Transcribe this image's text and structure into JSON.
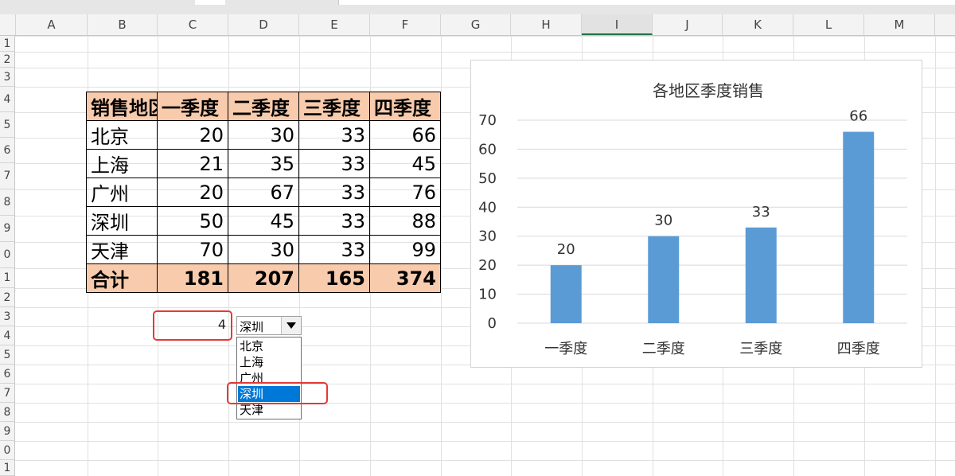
{
  "columns": [
    "A",
    "B",
    "C",
    "D",
    "E",
    "F",
    "G",
    "H",
    "I",
    "J",
    "K",
    "L",
    "M"
  ],
  "selected_column": "I",
  "rows": [
    "1",
    "2",
    "3",
    "4",
    "5",
    "6",
    "7",
    "8",
    "9",
    "0",
    "1",
    "2",
    "3",
    "4",
    "5",
    "6",
    "7",
    "8",
    "9",
    "0",
    "1"
  ],
  "table": {
    "header": [
      "销售地区",
      "一季度",
      "二季度",
      "三季度",
      "四季度"
    ],
    "rows": [
      [
        "北京",
        "20",
        "30",
        "33",
        "66"
      ],
      [
        "上海",
        "21",
        "35",
        "33",
        "45"
      ],
      [
        "广州",
        "20",
        "67",
        "33",
        "76"
      ],
      [
        "深圳",
        "50",
        "45",
        "33",
        "88"
      ],
      [
        "天津",
        "70",
        "30",
        "33",
        "99"
      ]
    ],
    "total": [
      "合计",
      "181",
      "207",
      "165",
      "374"
    ]
  },
  "linked_cell_value": "4",
  "combo": {
    "selected": "深圳",
    "options": [
      "北京",
      "上海",
      "广州",
      "深圳",
      "天津"
    ],
    "highlighted_index": 3
  },
  "colors": {
    "bar": "#5b9bd5",
    "highlight_box": "#e53935",
    "header_fill": "#f8cbad",
    "list_highlight": "#0078d7"
  },
  "chart_data": {
    "type": "bar",
    "title": "各地区季度销售",
    "categories": [
      "一季度",
      "二季度",
      "三季度",
      "四季度"
    ],
    "values": [
      20,
      30,
      33,
      66
    ],
    "ylim": [
      0,
      70
    ],
    "yticks": [
      0,
      10,
      20,
      30,
      40,
      50,
      60,
      70
    ],
    "grid": true,
    "data_labels": true
  }
}
